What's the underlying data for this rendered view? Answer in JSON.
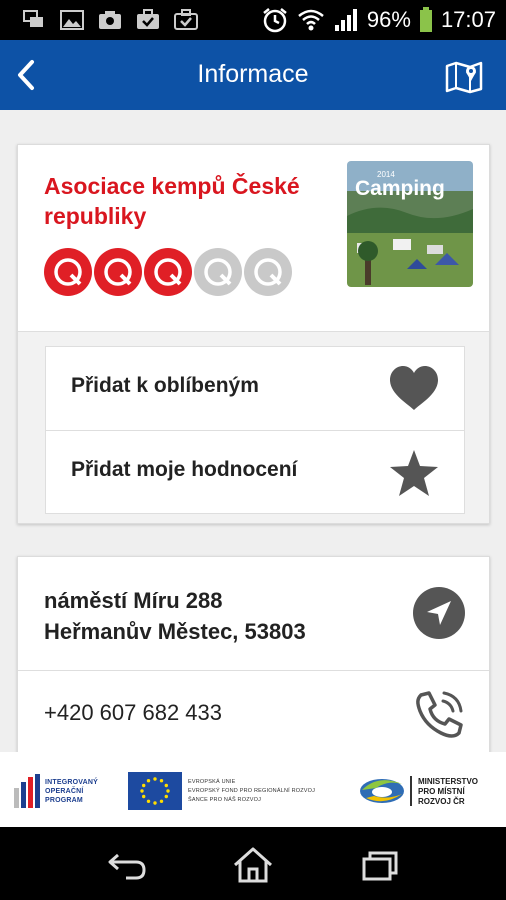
{
  "status_bar": {
    "battery": "96%",
    "time": "17:07"
  },
  "app_bar": {
    "title": "Informace"
  },
  "camp": {
    "name": "Asociace kempů České republiky",
    "rating": {
      "value": 3,
      "max": 5
    },
    "thumbnail": {
      "caption": "Camping",
      "year": "2014"
    }
  },
  "actions": [
    {
      "label": "Přidat k oblíbeným",
      "icon": "heart-icon"
    },
    {
      "label": "Přidat moje hodnocení",
      "icon": "star-icon"
    }
  ],
  "contact": {
    "address_line1": "náměstí Míru 288",
    "address_line2": "Heřmanův Městec, 53803",
    "phone": "+420 607 682 433"
  },
  "logos": {
    "iop_line1": "INTEGROVANÝ",
    "iop_line2": "OPERAČNÍ",
    "iop_line3": "PROGRAM",
    "eu_line1": "EVROPSKÁ UNIE",
    "eu_line2": "EVROPSKÝ FOND PRO REGIONÁLNÍ ROZVOJ",
    "eu_line3": "ŠANCE PRO NÁŠ ROZVOJ",
    "mmr_line1": "MINISTERSTVO",
    "mmr_line2": "PRO MÍSTNÍ",
    "mmr_line3": "ROZVOJ ČR"
  },
  "colors": {
    "app_bar": "#0d52a6",
    "accent_red": "#d9161f",
    "rating_off": "#c9c9c9"
  }
}
